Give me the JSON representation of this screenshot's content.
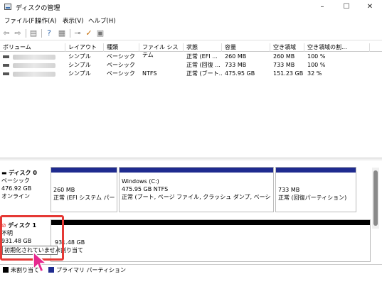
{
  "window": {
    "title": "ディスクの管理",
    "minimize": "–",
    "maximize": "☐",
    "close": "✕"
  },
  "menu": [
    "ファイル(F)",
    "操作(A)",
    "表示(V)",
    "ヘルプ(H)"
  ],
  "volume_table": {
    "columns": [
      "ボリューム",
      "レイアウト",
      "種類",
      "ファイル システム",
      "状態",
      "容量",
      "空き領域",
      "空き領域の割..."
    ],
    "rows": [
      {
        "layout": "シンプル",
        "type": "ベーシック",
        "fs": "",
        "status": "正常 (EFI ...",
        "capacity": "260 MB",
        "free": "260 MB",
        "pct": "100 %"
      },
      {
        "layout": "シンプル",
        "type": "ベーシック",
        "fs": "",
        "status": "正常 (回復 ...",
        "capacity": "733 MB",
        "free": "733 MB",
        "pct": "100 %"
      },
      {
        "layout": "シンプル",
        "type": "ベーシック",
        "fs": "NTFS",
        "status": "正常 (ブート...",
        "capacity": "475.95 GB",
        "free": "151.23 GB",
        "pct": "32 %"
      }
    ]
  },
  "disks": [
    {
      "name": "ディスク 0",
      "kind": "ベーシック",
      "size": "476.92 GB",
      "state": "オンライン",
      "partitions": [
        {
          "label": "",
          "size": "260 MB",
          "status": "正常 (EFI システム パーテ"
        },
        {
          "label": "Windows  (C:)",
          "size": "475.95 GB NTFS",
          "status": "正常 (ブート, ページ ファイル, クラッシュ ダンプ, ベーシック データ パ"
        },
        {
          "label": "",
          "size": "733 MB",
          "status": "正常 (回復パーティション)"
        }
      ]
    },
    {
      "name": "ディスク 1",
      "kind": "不明",
      "size": "931.48 GB",
      "state": "初期化されていません",
      "partitions": [
        {
          "size": "931.48 GB",
          "status": "未割り当て"
        }
      ]
    }
  ],
  "legend": [
    {
      "label": "未割り当て",
      "color": "#000000"
    },
    {
      "label": "プライマリ パーティション",
      "color": "#1f2b8f"
    }
  ]
}
